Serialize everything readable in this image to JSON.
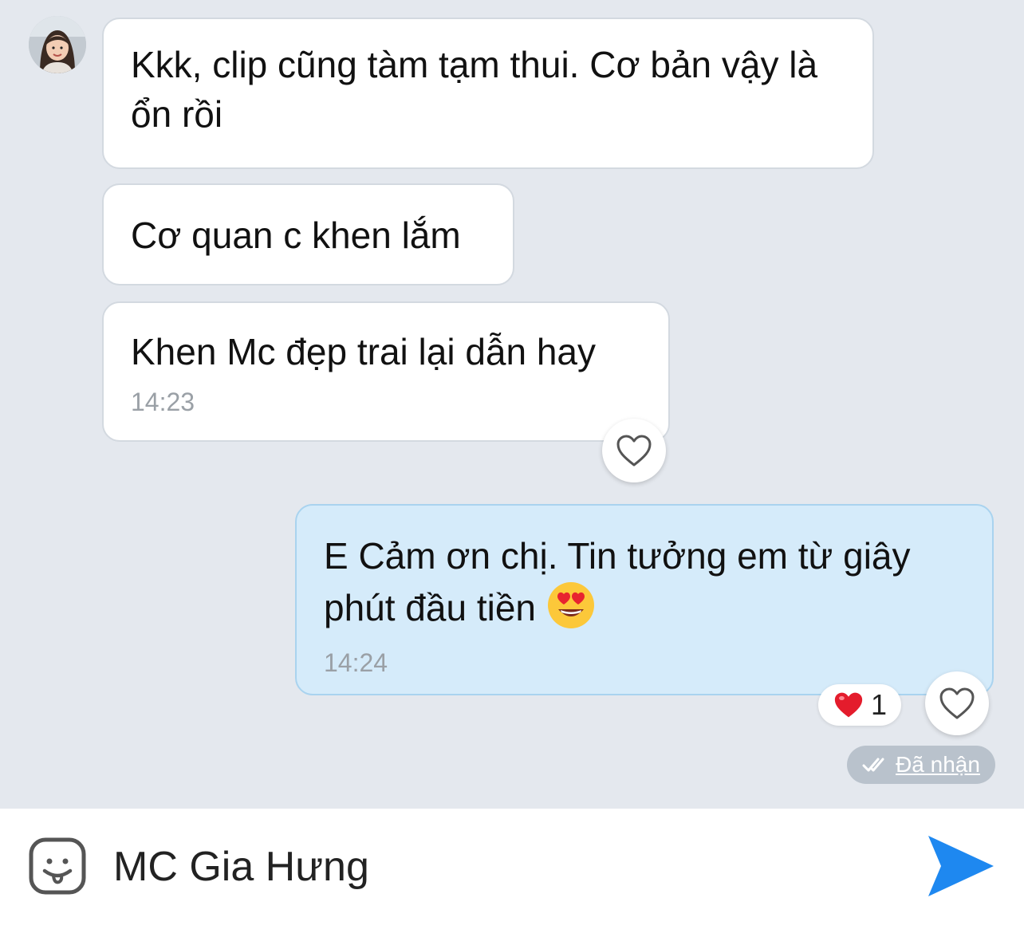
{
  "messages": [
    {
      "direction": "incoming",
      "text": "Kkk, clip cũng tàm tạm thui. Cơ bản vậy là ổn rồi"
    },
    {
      "direction": "incoming",
      "text": "Cơ quan c khen lắm"
    },
    {
      "direction": "incoming",
      "text": "Khen Mc đẹp trai lại dẫn hay",
      "time": "14:23"
    },
    {
      "direction": "outgoing",
      "text": "E Cảm ơn chị. Tin tưởng em từ giây phút đầu tiền",
      "emoji": "heart-eyes-emoji",
      "time": "14:24",
      "reaction_count": "1",
      "status": "Đã nhận"
    }
  ],
  "composer": {
    "text": "MC Gia Hưng"
  },
  "icons": {
    "sticker": "sticker-smile-icon",
    "send": "send-icon",
    "heart_outline": "heart-outline-icon",
    "heart_reaction": "red-heart-icon",
    "double_check": "double-check-icon"
  },
  "colors": {
    "chat_background": "#e4e8ee",
    "incoming_bubble": "#ffffff",
    "outgoing_bubble": "#d5ebfa",
    "send_accent": "#1e88f0",
    "timestamp": "#9aa0a6"
  }
}
